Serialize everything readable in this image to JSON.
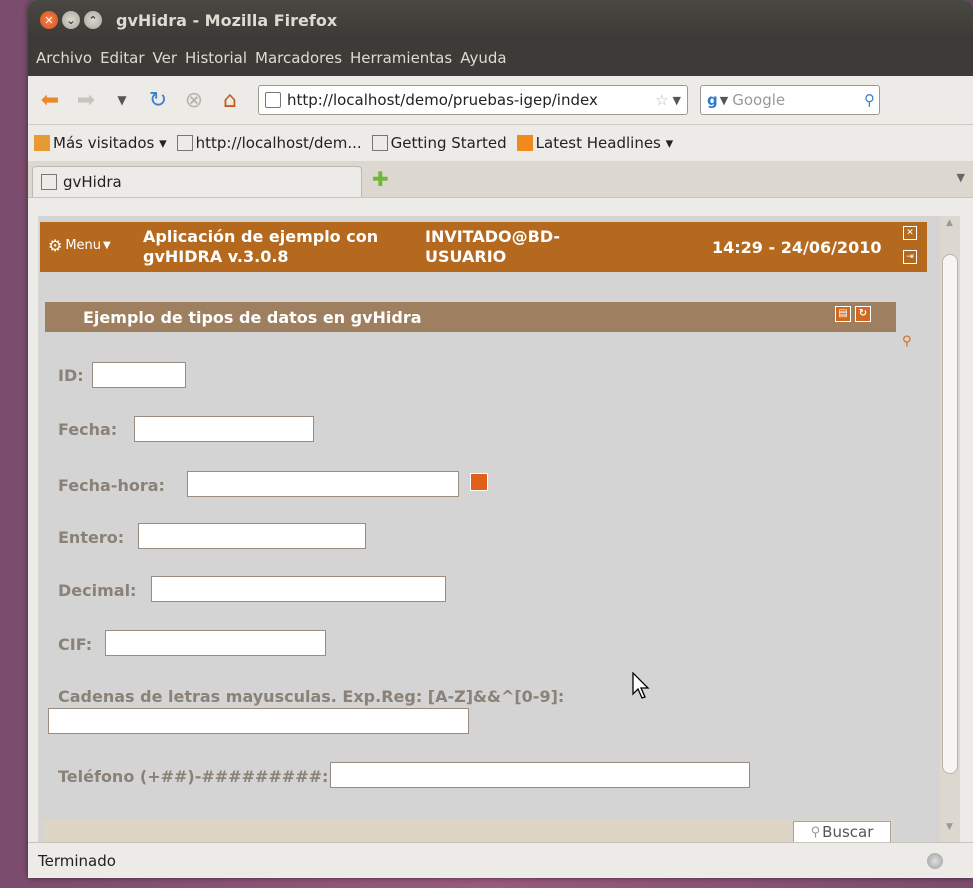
{
  "window": {
    "title": "gvHidra - Mozilla Firefox"
  },
  "menubar": [
    "Archivo",
    "Editar",
    "Ver",
    "Historial",
    "Marcadores",
    "Herramientas",
    "Ayuda"
  ],
  "nav": {
    "url": "http://localhost/demo/pruebas-igep/index",
    "search_placeholder": "Google"
  },
  "bookmarks": [
    "Más visitados ▾",
    "http://localhost/dem...",
    "Getting Started",
    "Latest Headlines ▾"
  ],
  "tab": {
    "label": "gvHidra"
  },
  "app_header": {
    "menu_label": "Menu",
    "title": "Aplicación de ejemplo con gvHIDRA  v.3.0.8",
    "user": "INVITADO@BD-USUARIO",
    "datetime": "14:29 - 24/06/2010"
  },
  "panel": {
    "title": "Ejemplo de tipos de datos en gvHidra"
  },
  "fields": {
    "id": "ID:",
    "fecha": "Fecha:",
    "fecha_hora": "Fecha-hora:",
    "entero": "Entero:",
    "decimal": "Decimal:",
    "cif": "CIF:",
    "cadenas": "Cadenas de letras mayusculas. Exp.Reg: [A-Z]&&^[0-9]:",
    "telefono": "Teléfono (+##)-#########:"
  },
  "buttons": {
    "buscar": "Buscar"
  },
  "status": {
    "text": "Terminado"
  },
  "colors": {
    "header": "#b5691f",
    "panel_header": "#9e8060",
    "label": "#8a8177",
    "content_bg": "#d4d4d4"
  }
}
